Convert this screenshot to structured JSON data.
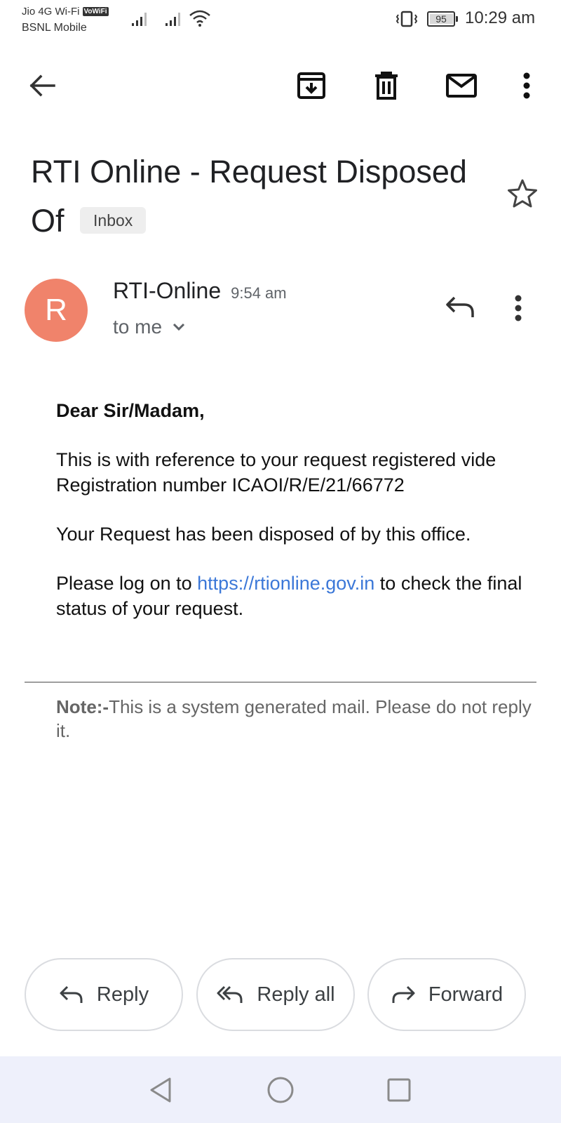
{
  "status_bar": {
    "carrier_1": "Jio 4G Wi-Fi",
    "vowifi_badge": "VoWiFi",
    "carrier_2": "BSNL Mobile",
    "battery_level": "95",
    "time": "10:29 am"
  },
  "toolbar": {
    "icons": [
      "back-arrow-icon",
      "archive-icon",
      "delete-icon",
      "mark-unread-icon",
      "more-vert-icon"
    ]
  },
  "email": {
    "subject": "RTI Online - Request Disposed Of",
    "label": "Inbox",
    "sender": {
      "initial": "R",
      "name": "RTI-Online",
      "time": "9:54 am",
      "recipients": "to me",
      "avatar_color": "#f0836b"
    },
    "body": {
      "greeting": "Dear Sir/Madam,",
      "para1": "This is with reference to your request registered vide Registration number ICAOI/R/E/21/66772",
      "para2": "Your Request has been disposed of by this office.",
      "para3_prefix": "Please log on to ",
      "para3_link": "https://rtionline.gov.in",
      "para3_suffix": " to check the final status of your request."
    },
    "note": {
      "label": "Note:-",
      "text": "This is a system generated mail. Please do not reply it."
    }
  },
  "actions": {
    "reply": "Reply",
    "reply_all": "Reply all",
    "forward": "Forward"
  },
  "colors": {
    "link": "#3c78d8",
    "avatar": "#f0836b",
    "nav_bar_bg": "#eef0fb"
  }
}
